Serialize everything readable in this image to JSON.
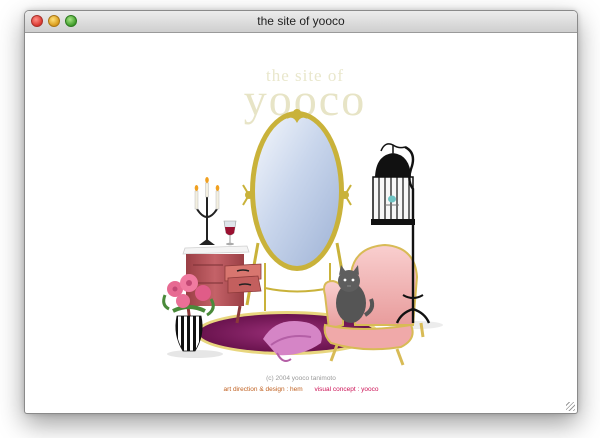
{
  "window": {
    "title": "the site of yooco"
  },
  "logo": {
    "small": "the site of",
    "big": "yooco"
  },
  "footer": {
    "copyright": "(c) 2004 yooco tanimoto",
    "art_direction": "art direction & design : hem",
    "visual_concept": "visual concept : yooco"
  },
  "colors": {
    "gold": "#c9b23a",
    "rug": "#7a1c5c",
    "chair": "#f2b7b7",
    "dresser": "#b5565a",
    "logo": "#e7e4c6",
    "credit_orange": "#c06020",
    "credit_pink": "#cc1155"
  },
  "icons": {
    "close": "close-icon",
    "minimize": "minimize-icon",
    "maximize": "maximize-icon",
    "resize": "resize-grip-icon"
  }
}
